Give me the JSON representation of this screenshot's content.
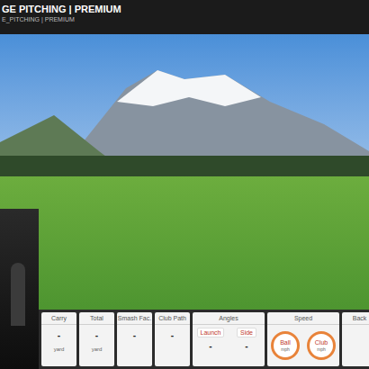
{
  "header": {
    "title": "GE PITCHING | PREMIUM",
    "subtitle": "E_PITCHING | PREMIUM"
  },
  "metrics": [
    {
      "kind": "single",
      "label": "Carry",
      "value": "-",
      "unit": "yard"
    },
    {
      "kind": "single",
      "label": "Total",
      "value": "-",
      "unit": "yard"
    },
    {
      "kind": "single",
      "label": "Smash Fac.",
      "value": "-"
    },
    {
      "kind": "single",
      "label": "Club Path",
      "value": "-"
    },
    {
      "kind": "double",
      "label": "Angles",
      "items": [
        {
          "label": "Launch",
          "value": "-"
        },
        {
          "label": "Side",
          "value": "-"
        }
      ]
    },
    {
      "kind": "gauge",
      "label": "Speed",
      "items": [
        {
          "label": "Ball",
          "unit": "mph"
        },
        {
          "label": "Club",
          "unit": "mph"
        }
      ]
    },
    {
      "kind": "single",
      "label": "Back"
    }
  ]
}
